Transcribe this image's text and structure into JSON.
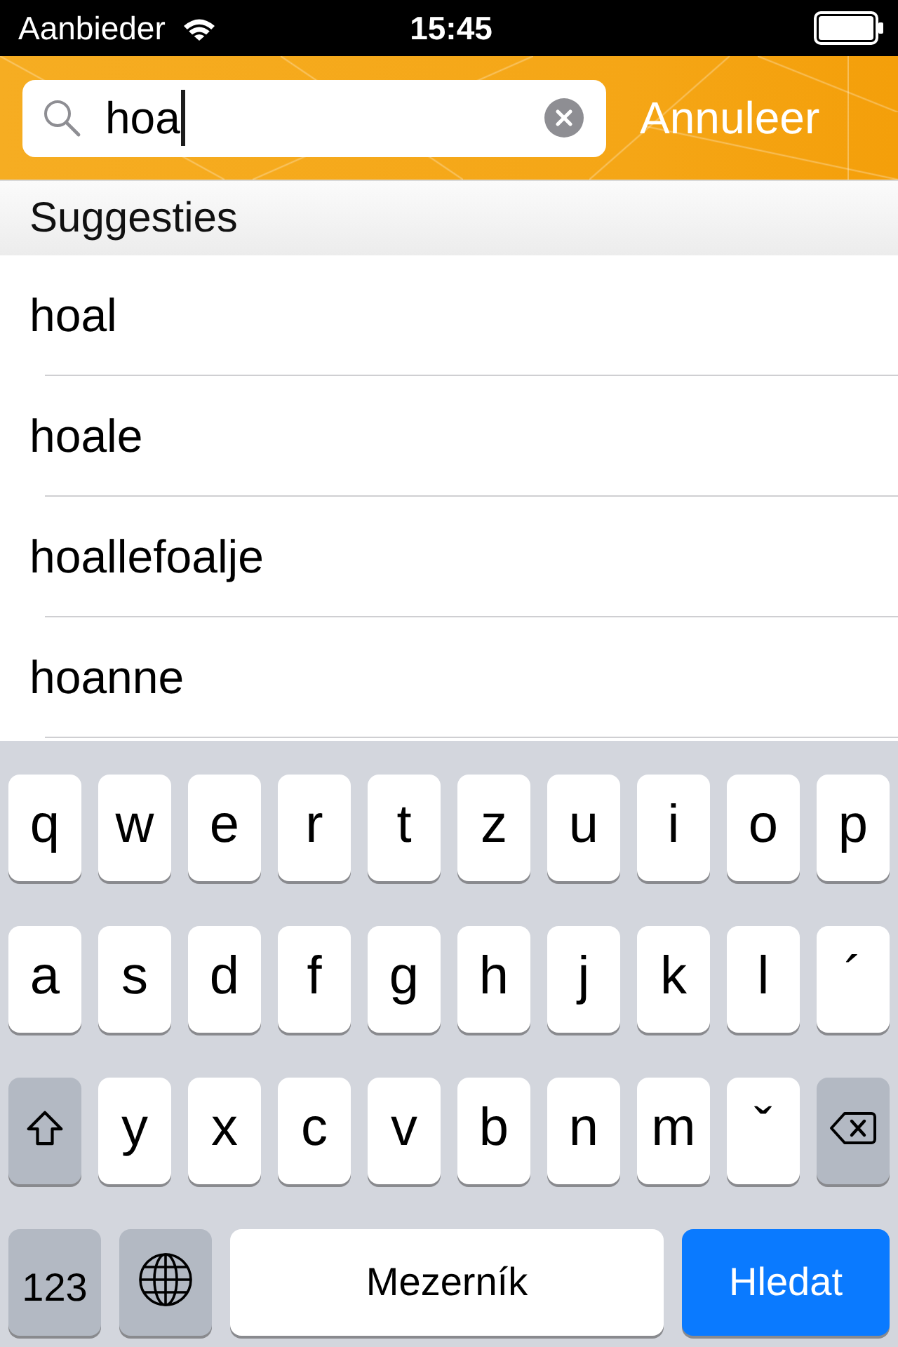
{
  "status_bar": {
    "carrier": "Aanbieder",
    "time": "15:45"
  },
  "search": {
    "value": "hoa",
    "focused": true,
    "cancel": "Annuleer"
  },
  "suggestions": {
    "header": "Suggesties",
    "items": [
      "hoal",
      "hoale",
      "hoallefoalje",
      "hoanne"
    ]
  },
  "keyboard": {
    "letter_rows": [
      [
        {
          "kind": "letter",
          "label": "q"
        },
        {
          "kind": "letter",
          "label": "w"
        },
        {
          "kind": "letter",
          "label": "e"
        },
        {
          "kind": "letter",
          "label": "r"
        },
        {
          "kind": "letter",
          "label": "t"
        },
        {
          "kind": "letter",
          "label": "z"
        },
        {
          "kind": "letter",
          "label": "u"
        },
        {
          "kind": "letter",
          "label": "i"
        },
        {
          "kind": "letter",
          "label": "o"
        },
        {
          "kind": "letter",
          "label": "p"
        }
      ],
      [
        {
          "kind": "letter",
          "label": "a"
        },
        {
          "kind": "letter",
          "label": "s"
        },
        {
          "kind": "letter",
          "label": "d"
        },
        {
          "kind": "letter",
          "label": "f"
        },
        {
          "kind": "letter",
          "label": "g"
        },
        {
          "kind": "letter",
          "label": "h"
        },
        {
          "kind": "letter",
          "label": "j"
        },
        {
          "kind": "letter",
          "label": "k"
        },
        {
          "kind": "letter",
          "label": "l"
        },
        {
          "kind": "letter",
          "label": "´"
        }
      ],
      [
        {
          "kind": "shift"
        },
        {
          "kind": "letter",
          "label": "y"
        },
        {
          "kind": "letter",
          "label": "x"
        },
        {
          "kind": "letter",
          "label": "c"
        },
        {
          "kind": "letter",
          "label": "v"
        },
        {
          "kind": "letter",
          "label": "b"
        },
        {
          "kind": "letter",
          "label": "n"
        },
        {
          "kind": "letter",
          "label": "m"
        },
        {
          "kind": "letter",
          "label": "ˇ"
        },
        {
          "kind": "delete"
        }
      ]
    ],
    "bottom_keys": [
      {
        "kind": "mode",
        "label": "123"
      },
      {
        "kind": "globe"
      },
      {
        "kind": "space",
        "label": "Mezerník"
      },
      {
        "kind": "action",
        "label": "Hledat"
      }
    ]
  }
}
